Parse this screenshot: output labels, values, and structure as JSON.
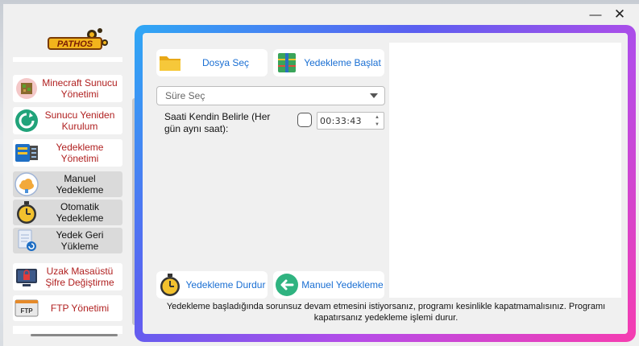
{
  "window": {
    "minimize_glyph": "—",
    "close_glyph": "✕"
  },
  "logo": {
    "text": "PATHOS"
  },
  "sidebar": {
    "items": [
      {
        "label": "Minecraft Sunucu Yönetimi",
        "icon": "minecraft-icon",
        "style": "red"
      },
      {
        "label": "Sunucu Yeniden Kurulum",
        "icon": "refresh-icon",
        "style": "red"
      },
      {
        "label": "Yedekleme Yönetimi",
        "icon": "backup-folder-icon",
        "style": "red"
      },
      {
        "label": "Manuel Yedekleme",
        "icon": "cloud-icon",
        "style": "dark"
      },
      {
        "label": "Otomatik Yedekleme",
        "icon": "clock-icon",
        "style": "dark"
      },
      {
        "label": "Yedek Geri Yükleme",
        "icon": "restore-icon",
        "style": "dark"
      },
      {
        "label": "Uzak Masaüstü Şifre Değiştirme",
        "icon": "lock-screen-icon",
        "style": "red"
      },
      {
        "label": "FTP Yönetimi",
        "icon": "ftp-icon",
        "style": "red"
      }
    ]
  },
  "main": {
    "select_folder_label": "Dosya Seç",
    "start_backup_label": "Yedekleme Başlat",
    "duration_placeholder": "Süre Seç",
    "manual_time_label": "Saati Kendin Belirle (Her gün aynı saat):",
    "time_value": "00:33:43",
    "stop_backup_label": "Yedekleme Durdur",
    "manual_backup_label": "Manuel Yedekleme",
    "warning_text": "Yedekleme başladığında sorunsuz devam etmesini istiyorsanız, programı kesinlikle kapatmamalısınız. Programı kapatırsanız yedekleme işlemi durur."
  },
  "colors": {
    "accent_blue": "#1a6fd3",
    "accent_red": "#b02020",
    "gradient": [
      "#2fa8f5",
      "#5b5ff0",
      "#b54ce8",
      "#f63db0"
    ]
  }
}
